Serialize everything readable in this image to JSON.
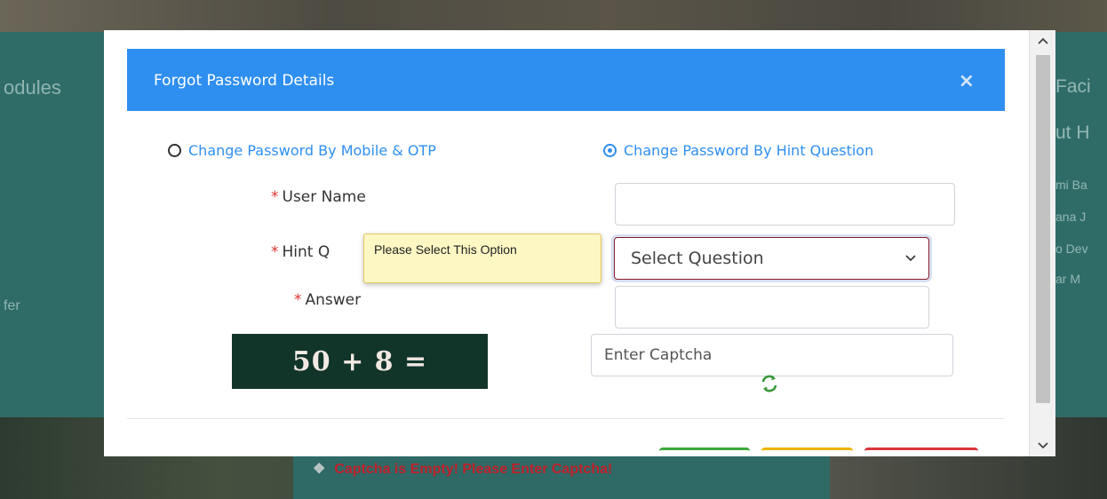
{
  "background": {
    "left_heading": "odules",
    "left_text": "fer",
    "right_heading": "Faci",
    "right_subheading": "ut H",
    "right_items": [
      "mi Ba",
      "ana J",
      "o Dev",
      "ar M"
    ],
    "error_message": "Captcha is Empty! Please Enter Captcha!"
  },
  "modal": {
    "title": "Forgot Password Details",
    "close_symbol": "×",
    "options": {
      "mobile_otp": "Change Password By Mobile & OTP",
      "hint_question": "Change Password By Hint Question",
      "selected": "hint_question"
    },
    "required_mark": "*",
    "fields": {
      "user_name_label": "User Name",
      "user_name_value": "",
      "hint_question_label": "Hint Q",
      "hint_question_selected": "Select Question",
      "answer_label": "Answer",
      "answer_value": ""
    },
    "tooltip": "Please Select This Option",
    "captcha": {
      "challenge": "50 + 8 =",
      "placeholder": "Enter Captcha"
    }
  },
  "colors": {
    "accent": "#2f8ff0",
    "required": "#e0352b",
    "error": "#c0202a"
  },
  "icons": {
    "close": "close-icon",
    "refresh": "refresh-captcha-icon",
    "dropdown": "chevron-down-icon",
    "scroll_up": "scroll-up-icon",
    "scroll_down": "scroll-down-icon"
  }
}
